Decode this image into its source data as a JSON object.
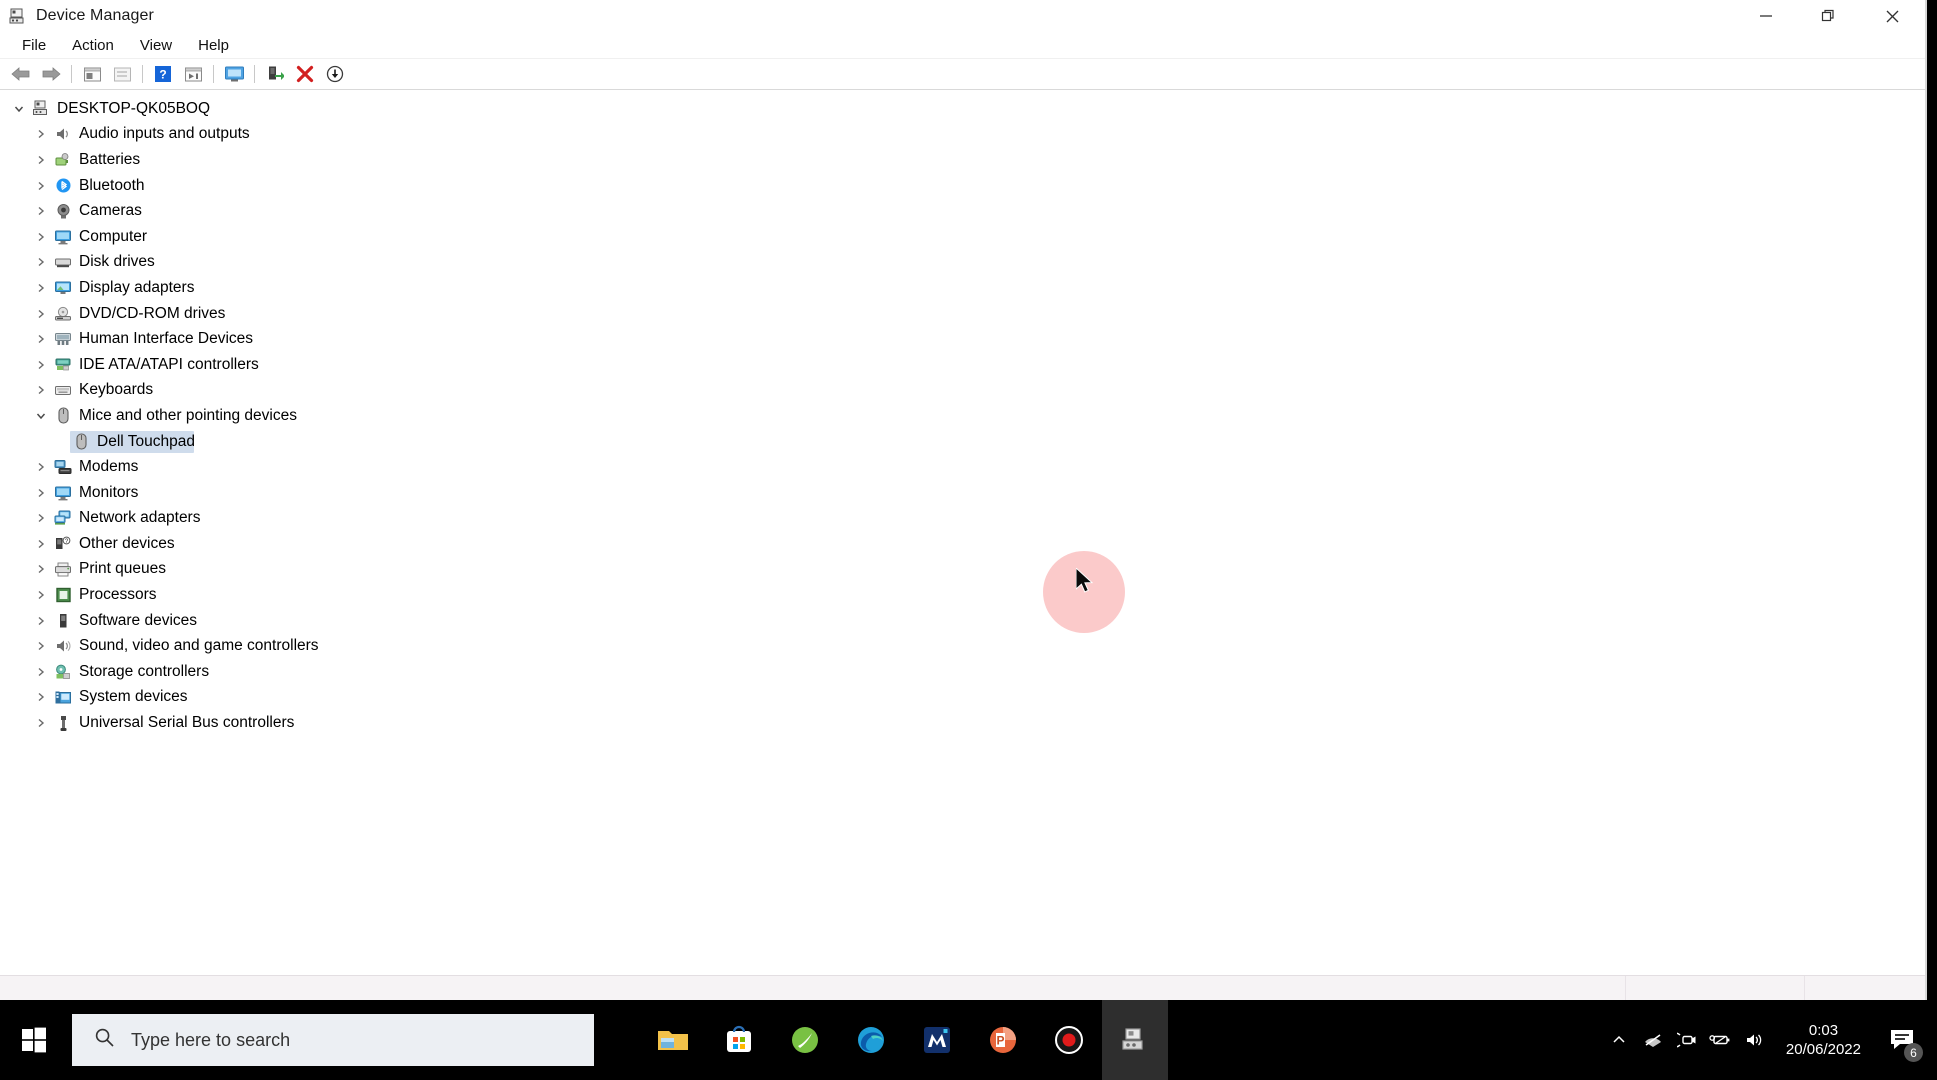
{
  "window": {
    "title": "Device Manager",
    "icon": "device-manager-icon",
    "controls": {
      "minimize": "—",
      "restore": "❐",
      "close": "✕"
    }
  },
  "menu": {
    "items": [
      "File",
      "Action",
      "View",
      "Help"
    ]
  },
  "toolbar": {
    "buttons": [
      {
        "name": "back-icon"
      },
      {
        "name": "forward-icon"
      },
      {
        "name": "separator"
      },
      {
        "name": "properties-icon"
      },
      {
        "name": "update-driver-icon"
      },
      {
        "name": "separator"
      },
      {
        "name": "help-icon"
      },
      {
        "name": "show-hidden-devices-icon"
      },
      {
        "name": "separator"
      },
      {
        "name": "scan-hardware-changes-icon"
      },
      {
        "name": "separator"
      },
      {
        "name": "enable-device-icon"
      },
      {
        "name": "uninstall-device-icon"
      },
      {
        "name": "disable-device-icon"
      }
    ]
  },
  "tree": {
    "root": {
      "label": "DESKTOP-QK05BOQ",
      "icon": "computer-root-icon",
      "expanded": true
    },
    "nodes": [
      {
        "label": "Audio inputs and outputs",
        "icon": "speaker-icon",
        "expanded": false,
        "depth": 1
      },
      {
        "label": "Batteries",
        "icon": "battery-icon",
        "expanded": false,
        "depth": 1
      },
      {
        "label": "Bluetooth",
        "icon": "bluetooth-icon",
        "expanded": false,
        "depth": 1
      },
      {
        "label": "Cameras",
        "icon": "camera-icon",
        "expanded": false,
        "depth": 1
      },
      {
        "label": "Computer",
        "icon": "monitor-icon",
        "expanded": false,
        "depth": 1
      },
      {
        "label": "Disk drives",
        "icon": "disk-drive-icon",
        "expanded": false,
        "depth": 1
      },
      {
        "label": "Display adapters",
        "icon": "display-adapter-icon",
        "expanded": false,
        "depth": 1
      },
      {
        "label": "DVD/CD-ROM drives",
        "icon": "dvd-drive-icon",
        "expanded": false,
        "depth": 1
      },
      {
        "label": "Human Interface Devices",
        "icon": "hid-icon",
        "expanded": false,
        "depth": 1
      },
      {
        "label": "IDE ATA/ATAPI controllers",
        "icon": "ide-controller-icon",
        "expanded": false,
        "depth": 1
      },
      {
        "label": "Keyboards",
        "icon": "keyboard-icon",
        "expanded": false,
        "depth": 1
      },
      {
        "label": "Mice and other pointing devices",
        "icon": "mouse-icon",
        "expanded": true,
        "depth": 1
      },
      {
        "label": "Dell Touchpad",
        "icon": "mouse-icon",
        "expanded": null,
        "depth": 2,
        "selected": true
      },
      {
        "label": "Modems",
        "icon": "modem-icon",
        "expanded": false,
        "depth": 1
      },
      {
        "label": "Monitors",
        "icon": "monitor-icon",
        "expanded": false,
        "depth": 1
      },
      {
        "label": "Network adapters",
        "icon": "network-adapter-icon",
        "expanded": false,
        "depth": 1
      },
      {
        "label": "Other devices",
        "icon": "other-device-icon",
        "expanded": false,
        "depth": 1
      },
      {
        "label": "Print queues",
        "icon": "printer-icon",
        "expanded": false,
        "depth": 1
      },
      {
        "label": "Processors",
        "icon": "processor-icon",
        "expanded": false,
        "depth": 1
      },
      {
        "label": "Software devices",
        "icon": "software-device-icon",
        "expanded": false,
        "depth": 1
      },
      {
        "label": "Sound, video and game controllers",
        "icon": "sound-controller-icon",
        "expanded": false,
        "depth": 1
      },
      {
        "label": "Storage controllers",
        "icon": "storage-controller-icon",
        "expanded": false,
        "depth": 1
      },
      {
        "label": "System devices",
        "icon": "system-device-icon",
        "expanded": false,
        "depth": 1
      },
      {
        "label": "Universal Serial Bus controllers",
        "icon": "usb-controller-icon",
        "expanded": false,
        "depth": 1
      }
    ]
  },
  "statusbar": {
    "text": ""
  },
  "taskbar": {
    "start": {
      "name": "start-button"
    },
    "search": {
      "placeholder": "Type here to search",
      "value": ""
    },
    "apps": [
      {
        "name": "file-explorer-icon",
        "active": false
      },
      {
        "name": "microsoft-store-icon",
        "active": false
      },
      {
        "name": "green-app-icon",
        "active": false
      },
      {
        "name": "microsoft-edge-icon",
        "active": false
      },
      {
        "name": "blue-m-app-icon",
        "active": false
      },
      {
        "name": "powerpoint-icon",
        "active": false
      },
      {
        "name": "screen-recorder-icon",
        "active": false
      },
      {
        "name": "device-manager-taskbar-icon",
        "active": true
      }
    ],
    "tray": {
      "icons": [
        "show-hidden-icons-chevron",
        "network-disconnected-icon",
        "camera-privacy-icon",
        "battery-icon",
        "volume-icon"
      ],
      "clock": {
        "time": "0:03",
        "date": "20/06/2022"
      },
      "notifications": {
        "name": "action-center-icon",
        "count": "6"
      }
    }
  },
  "colors": {
    "selection": "#cfdcec",
    "taskbar_bg": "#000000",
    "search_bg": "#eceff3",
    "click_highlight": "#fbc7c7",
    "window_bg": "#ffffff"
  }
}
